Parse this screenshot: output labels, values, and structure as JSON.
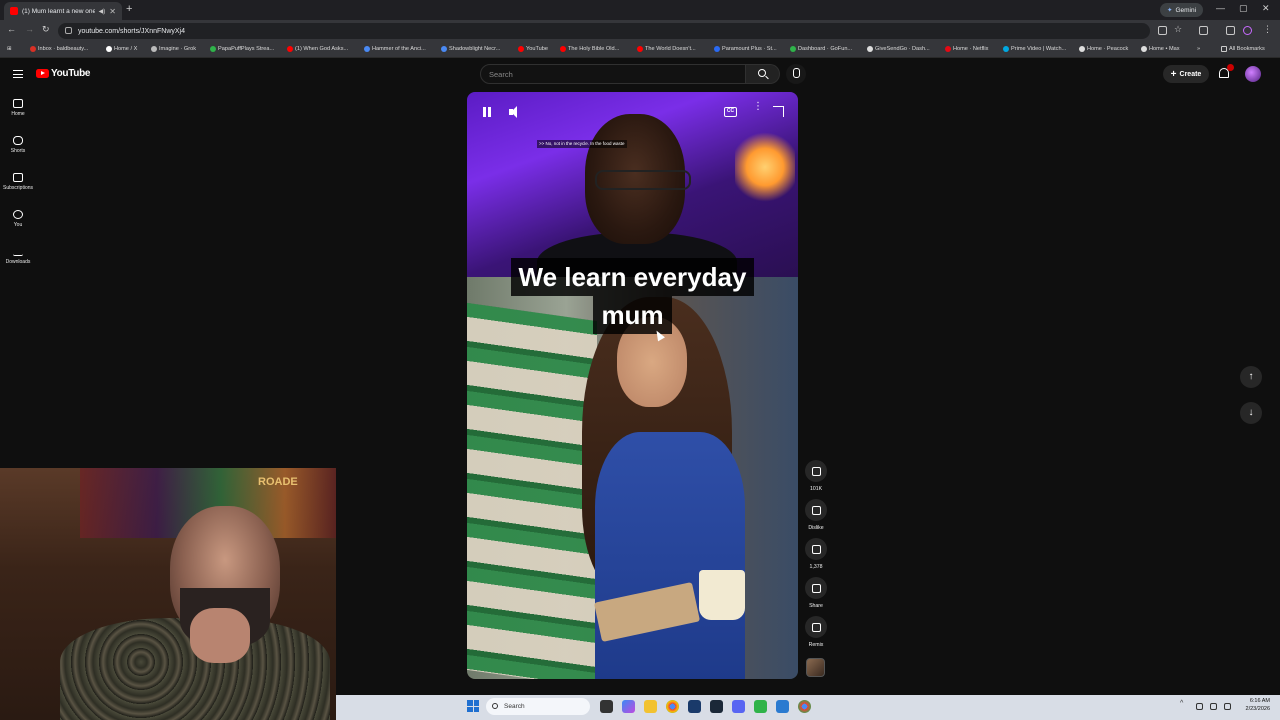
{
  "browser": {
    "tab_title": "(1) Mum learnt a new one",
    "url": "youtube.com/shorts/JXnnFNwyXj4",
    "gemini_label": "Gemini",
    "bookmarks": [
      {
        "label": "Inbox · baldbeauty...",
        "color": "#d93025"
      },
      {
        "label": "Home / X",
        "color": "#ffffff"
      },
      {
        "label": "Imagine · Grok",
        "color": "#bbbbbb"
      },
      {
        "label": "PapaPuffPlays Strea...",
        "color": "#2fb34a"
      },
      {
        "label": "(1) When God Asks...",
        "color": "#ff0000"
      },
      {
        "label": "Hammer of the Anci...",
        "color": "#4a8af4"
      },
      {
        "label": "Shadowblight Necr...",
        "color": "#4a8af4"
      },
      {
        "label": "YouTube",
        "color": "#ff0000"
      },
      {
        "label": "The Holy Bible Old...",
        "color": "#ff0000"
      },
      {
        "label": "The World Doesn't...",
        "color": "#ff0000"
      },
      {
        "label": "Paramount Plus · St...",
        "color": "#2a6af4"
      },
      {
        "label": "Dashboard · GoFun...",
        "color": "#2fb34a"
      },
      {
        "label": "GiveSendGo · Dash...",
        "color": "#dddddd"
      },
      {
        "label": "Home · Netflix",
        "color": "#e50914"
      },
      {
        "label": "Prime Video | Watch...",
        "color": "#00a8e1"
      },
      {
        "label": "Home · Peacock",
        "color": "#dddddd"
      },
      {
        "label": "Home • Max",
        "color": "#dddddd"
      }
    ],
    "all_bookmarks_label": "All Bookmarks"
  },
  "youtube": {
    "logo_text": "YouTube",
    "search_placeholder": "Search",
    "create_label": "Create",
    "guide": [
      {
        "label": "Home",
        "icon": "home-icon"
      },
      {
        "label": "Shorts",
        "icon": "shorts-icon"
      },
      {
        "label": "Subscriptions",
        "icon": "subscriptions-icon"
      },
      {
        "label": "You",
        "icon": "you-icon"
      },
      {
        "label": "Downloads",
        "icon": "download-icon"
      }
    ],
    "short": {
      "cc_text": ">> No, not in the recycle. In the food waste",
      "caption_line1": "We learn everyday",
      "caption_line2": "mum",
      "cc_button": "CC"
    },
    "actions": [
      {
        "label": "101K",
        "icon": "like-icon"
      },
      {
        "label": "Dislike",
        "icon": "dislike-icon"
      },
      {
        "label": "1,378",
        "icon": "comment-icon"
      },
      {
        "label": "Share",
        "icon": "share-icon"
      },
      {
        "label": "Remix",
        "icon": "remix-icon"
      }
    ]
  },
  "webcam": {
    "poster_text": "ROADE"
  },
  "taskbar": {
    "search_label": "Search",
    "time": "6:16 AM",
    "date": "2/23/2026"
  },
  "colors": {
    "yt_red": "#ff0000",
    "background": "#0f0f0f",
    "taskbar": "#d8dde6"
  }
}
